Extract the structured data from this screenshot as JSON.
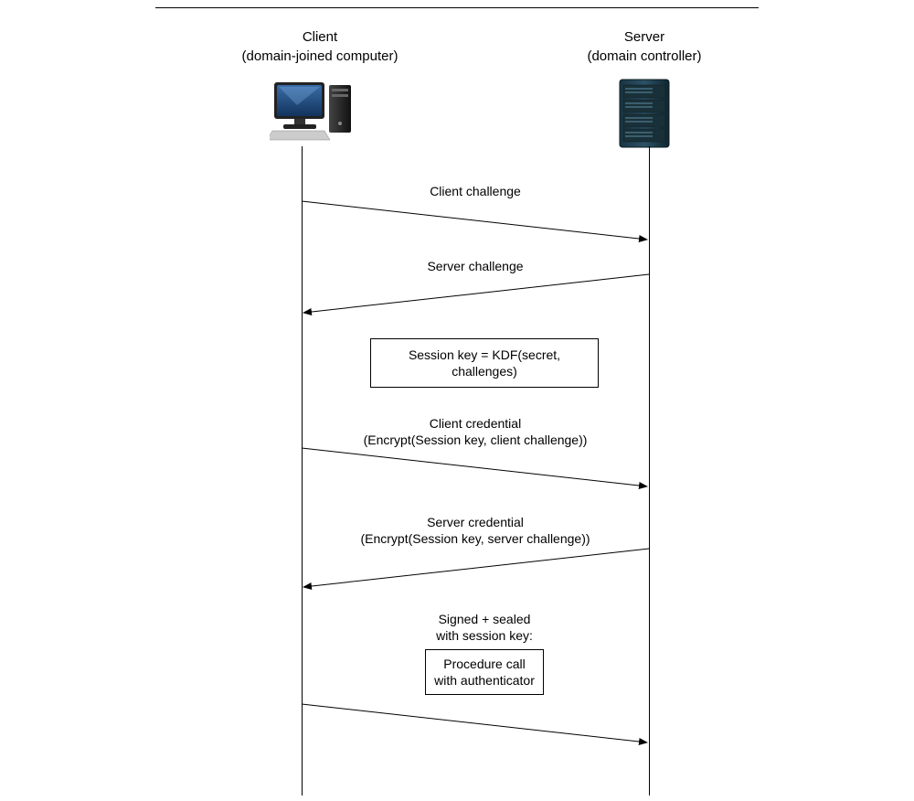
{
  "participants": {
    "client": {
      "title": "Client",
      "subtitle": "(domain-joined computer)"
    },
    "server": {
      "title": "Server",
      "subtitle": "(domain controller)"
    }
  },
  "messages": {
    "m1": "Client challenge",
    "m2": "Server challenge",
    "m3_line1": "Client credential",
    "m3_line2": "(Encrypt(Session key, client challenge))",
    "m4_line1": "Server credential",
    "m4_line2": "(Encrypt(Session key, server challenge))"
  },
  "notes": {
    "session_key": "Session key = KDF(secret, challenges)",
    "signed_line1": "Signed + sealed",
    "signed_line2": "with session key:",
    "proc_line1": "Procedure call",
    "proc_line2": "with authenticator"
  }
}
